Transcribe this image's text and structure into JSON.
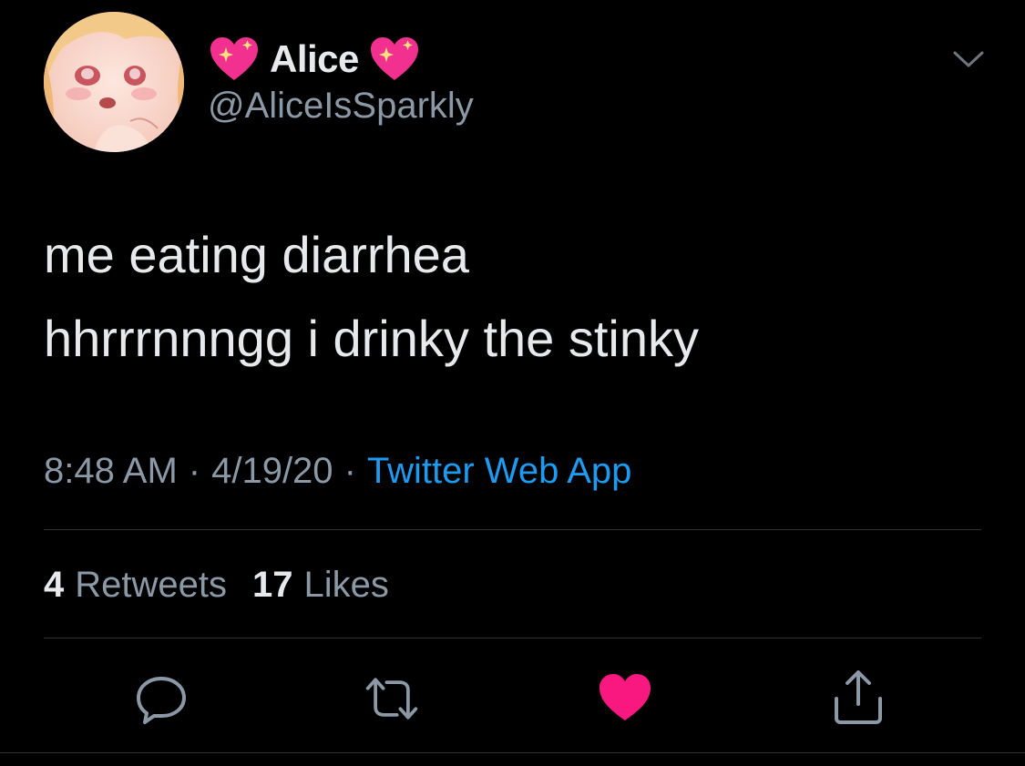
{
  "user": {
    "name": "Alice",
    "handle": "@AliceIsSparkly",
    "name_emoji_icon": "sparkling-heart-icon"
  },
  "tweet": {
    "lines": [
      "me eating diarrhea",
      "hhrrrnnngg i drinky the stinky"
    ]
  },
  "meta": {
    "time": "8:48 AM",
    "separator": "·",
    "date": "4/19/20",
    "source": "Twitter Web App"
  },
  "stats": {
    "retweets_count": "4",
    "retweets_label": "Retweets",
    "likes_count": "17",
    "likes_label": "Likes"
  },
  "actions": [
    "reply-icon",
    "retweet-icon",
    "like-icon",
    "share-icon"
  ],
  "colors": {
    "background": "#000000",
    "text": "#e7e9ea",
    "secondary": "#8b98a5",
    "link": "#1d9bf0",
    "like": "#f91880",
    "divider": "#2f3336"
  }
}
